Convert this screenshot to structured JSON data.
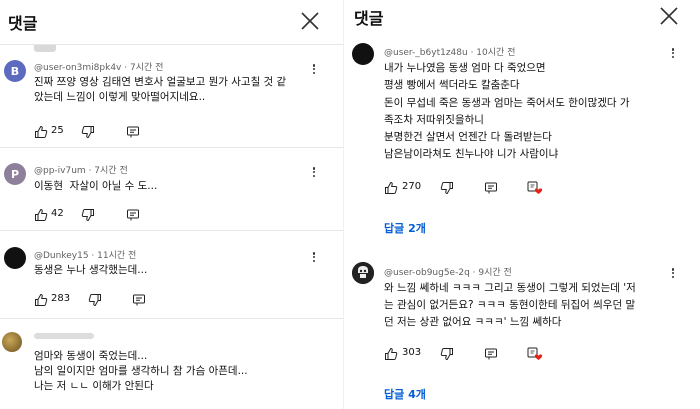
{
  "left": {
    "title": "댓글",
    "comments": [
      {
        "avatar_letter": "B",
        "avatar_color": "#5c6bc0",
        "user": "@user-on3mi8pk4v",
        "time": "7시간 전",
        "lines": [
          "진짜 쯔양 영상 김태연 변호사 얼굴보고 뭔가 사고칠 것 같",
          "았는데 느낌이 이렇게 맞아떨어지네요.."
        ],
        "likes": "25"
      },
      {
        "avatar_letter": "P",
        "avatar_color": "#8e7f9a",
        "user": "@pp-iv7um",
        "time": "7시간 전",
        "lines": [
          "이동현  자살이 아닐 수 도..."
        ],
        "likes": "42"
      },
      {
        "avatar_letter": "",
        "avatar_color": "#111111",
        "user": "@Dunkey15",
        "time": "11시간 전",
        "lines": [
          "동생은 누나 생각했는데..."
        ],
        "likes": "283"
      },
      {
        "avatar_letter": "",
        "avatar_color": "#8a6b2e",
        "user": "",
        "time": "",
        "lines": [
          "엄마와 동생이 죽었는데...",
          "남의 일이지만 엄마를 생각하니 참 가슴 아픈데...",
          "나는 저 ㄴㄴ 이해가 안된다"
        ],
        "likes": ""
      }
    ]
  },
  "right": {
    "title": "댓글",
    "comments": [
      {
        "avatar_color": "#111111",
        "user": "@user-_b6yt1z48u",
        "time": "10시간 전",
        "lines": [
          "내가 누나였음 동생 엄마 다 죽었으면",
          "평생 빵에서 썩더라도 칼춤춘다",
          "돈이 무섭네 죽은 동생과 엄마는 죽어서도 한이많겠다 가",
          "족조차 저따위짓을하니",
          "분명한건 살면서 언젠간 다 돌려받는다",
          "남은남이라쳐도 친누나야 니가 사람이냐"
        ],
        "likes": "270",
        "replies": "답글 2개"
      },
      {
        "avatar_color": "#222222",
        "user": "@user-ob9ug5e-2q",
        "time": "9시간 전",
        "lines": [
          "와 느낌 쎄하네 ㅋㅋㅋ 그리고 동생이 그렇게 되었는데 '저",
          "는 관심이 없거든요? ㅋㅋㅋ 동현이한테 뒤집어 씌우던 말",
          "던 저는 상관 없어요 ㅋㅋㅋ' 느낌 쎄하다"
        ],
        "likes": "303",
        "replies": "답글 4개"
      }
    ]
  },
  "icons": {
    "like": "thumbs-up-icon",
    "dislike": "thumbs-down-icon",
    "reply": "reply-icon",
    "creator_heart": "creator-heart-icon",
    "more": "more-vertical-icon",
    "close": "close-icon"
  },
  "colors": {
    "link": "#065fd4",
    "heart": "#e62117",
    "meta": "#606060"
  }
}
